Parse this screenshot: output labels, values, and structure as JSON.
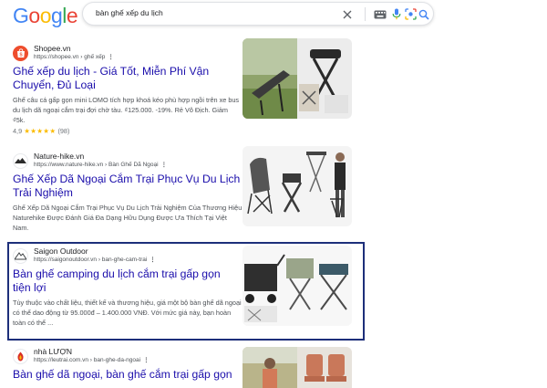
{
  "header": {
    "logo_letters": [
      {
        "ch": "G",
        "color": "#4285F4"
      },
      {
        "ch": "o",
        "color": "#EA4335"
      },
      {
        "ch": "o",
        "color": "#FBBC05"
      },
      {
        "ch": "g",
        "color": "#4285F4"
      },
      {
        "ch": "l",
        "color": "#34A853"
      },
      {
        "ch": "e",
        "color": "#EA4335"
      }
    ],
    "search_query": "bàn ghế xếp du lịch",
    "icons": [
      "close-icon",
      "keyboard-icon",
      "microphone-icon",
      "lens-icon",
      "search-icon"
    ]
  },
  "results": [
    {
      "site_name": "Shopee.vn",
      "url": "https://shopee.vn › ghế xếp",
      "title": "Ghế xếp du lịch - Giá Tốt, Miễn Phí Vận Chuyển, Đủ Loại",
      "snippet": "Ghế câu cá gấp gọn mini LOMO tích hợp khoá kéo phù hợp ngồi trên xe bus du lịch dã ngoại cắm trại đợi chờ tàu. ₫125.000. -19%. Rẻ Vô Địch. Giảm ₫5k.",
      "rating": "4,9",
      "stars": "★★★★★",
      "rating_count": "(98)",
      "favicon_color": "#ee4d2d"
    },
    {
      "site_name": "Nature-hike.vn",
      "url": "https://www.nature-hike.vn › Bàn Ghế Dã Ngoại",
      "title": "Ghế Xếp Dã Ngoại Cắm Trại Phục Vụ Du Lịch Trải Nghiệm",
      "snippet": "Ghế Xếp Dã Ngoại Cắm Trại Phục Vụ Du Lịch Trải Nghiệm Của Thương Hiệu Naturehike Được Đánh Giá Đa Dạng Hữu Dụng Được Ưa Thích Tại Việt Nam.",
      "favicon_color": "#2b2b2b"
    },
    {
      "site_name": "Saigon Outdoor",
      "url": "https://saigonoutdoor.vn › ban-ghe-cam-trai",
      "title": "Bàn ghế camping du lịch cắm trại gấp gọn tiện lợi",
      "snippet": "Tùy thuộc vào chất liệu, thiết kế và thương hiệu, giá một bộ bàn ghế dã ngoại có thể dao động từ 95.000đ – 1.400.000 VNĐ. Với mức giá này, bạn hoàn toàn có thể ...",
      "favicon_color": "#3c4043"
    },
    {
      "site_name": "nhà LƯỢN",
      "url": "https://leutrai.com.vn › ban-ghe-da-ngoai",
      "title": "Bàn ghế dã ngoại, bàn ghế cắm trại gấp gọn",
      "favicon_color": "#d93025"
    }
  ],
  "colors": {
    "link": "#1a0dab",
    "highlight_border": "#1d2f7a"
  }
}
